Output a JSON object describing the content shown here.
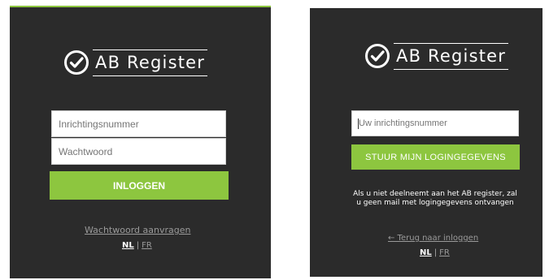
{
  "login": {
    "logo": {
      "brand": "AB Register",
      "icon": "checkmark-circle-icon"
    },
    "inrichtingsnummer_placeholder": "Inrichtingsnummer",
    "wachtwoord_placeholder": "Wachtwoord",
    "submit_label": "INLOGGEN",
    "forgot_link": "Wachtwoord aanvragen",
    "lang_nl": "NL",
    "lang_sep": "|",
    "lang_fr": "FR"
  },
  "reset": {
    "logo": {
      "brand": "AB Register",
      "icon": "checkmark-circle-icon"
    },
    "inrichtingsnummer_placeholder": "Uw inrichtingsnummer",
    "submit_label": "STUUR MIJN LOGINGEGEVENS",
    "notice": "Als u niet deelneemt aan het AB register, zal u geen mail met logingegevens ontvangen",
    "back_link": "← Terug naar inloggen",
    "lang_nl": "NL",
    "lang_sep": "|",
    "lang_fr": "FR"
  },
  "colors": {
    "panel_background": "#2b2b2b",
    "accent_green": "#8dc63f",
    "page_background": "#ffffff"
  }
}
